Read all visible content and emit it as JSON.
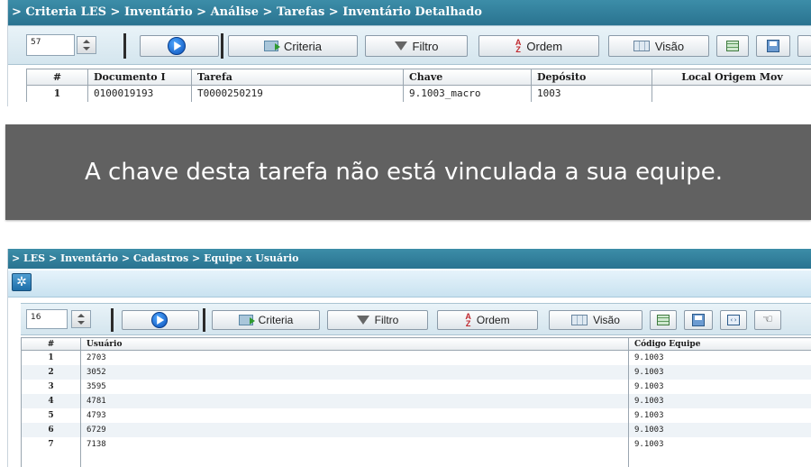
{
  "panel1": {
    "breadcrumb": "> Criteria LES > Inventário > Análise > Tarefas > Inventário Detalhado",
    "toolbar": {
      "rows_value": "57",
      "criteria_label": "Criteria",
      "filter_label": "Filtro",
      "order_label": "Ordem",
      "view_label": "Visão"
    },
    "table": {
      "columns": [
        "#",
        "Documento I",
        "Tarefa",
        "Chave",
        "Depósito",
        "Local Origem Mov"
      ],
      "rows": [
        [
          "1",
          "0100019193",
          "T0000250219",
          "9.1003_macro",
          "1003",
          ""
        ]
      ]
    }
  },
  "message": {
    "text": "A chave desta tarefa não está vinculada a sua equipe."
  },
  "panel2": {
    "breadcrumb": "> LES > Inventário > Cadastros > Equipe x Usuário",
    "toolbar": {
      "rows_value": "16",
      "criteria_label": "Criteria",
      "filter_label": "Filtro",
      "order_label": "Ordem",
      "view_label": "Visão"
    },
    "table": {
      "columns": [
        "#",
        "Usuário",
        "Código Equipe"
      ],
      "rows": [
        [
          "1",
          "2703",
          "9.1003"
        ],
        [
          "2",
          "3052",
          "9.1003"
        ],
        [
          "3",
          "3595",
          "9.1003"
        ],
        [
          "4",
          "4781",
          "9.1003"
        ],
        [
          "5",
          "4793",
          "9.1003"
        ],
        [
          "6",
          "6729",
          "9.1003"
        ],
        [
          "7",
          "7138",
          "9.1003"
        ]
      ]
    }
  },
  "icons": {
    "settings": "gear-icon",
    "run": "play-icon",
    "criteria": "criteria-icon",
    "filter": "funnel-icon",
    "order": "sort-az-icon",
    "view": "view-icon",
    "export": "export-grid-icon",
    "save": "save-icon",
    "code": "code-icon",
    "hand": "hand-icon"
  },
  "colors": {
    "titlebar": "#2f7c99",
    "banner": "#616161",
    "toolbar_band": "#dbeaf2"
  }
}
